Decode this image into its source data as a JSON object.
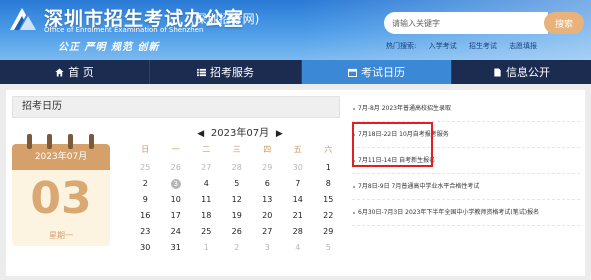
{
  "header": {
    "title": "深圳市招生考试办公室",
    "subtitle": "(深圳招考网)",
    "english": "Office of Enrolment Examination of Shenzhen",
    "slogan": "公正  严明  规范  创新",
    "search": {
      "placeholder": "请输入关键字",
      "button": "搜索"
    },
    "hot_label": "热门搜索:",
    "hot_items": [
      "入学考试",
      "招生考试",
      "志愿填报"
    ]
  },
  "nav": [
    {
      "label": "首 页",
      "icon": "home-icon",
      "active": false
    },
    {
      "label": "招考服务",
      "icon": "list-icon",
      "active": false
    },
    {
      "label": "考试日历",
      "icon": "calendar-icon",
      "active": true
    },
    {
      "label": "信息公开",
      "icon": "document-icon",
      "active": false
    }
  ],
  "section_title": "招考日历",
  "date_card": {
    "month": "2023年07月",
    "day": "03",
    "weekday": "星期一"
  },
  "calendar": {
    "title": "2023年07月",
    "prev": "◀",
    "next": "▶",
    "weekdays": [
      "日",
      "一",
      "二",
      "三",
      "四",
      "五",
      "六"
    ],
    "rows": [
      [
        {
          "d": "25",
          "m": true
        },
        {
          "d": "26",
          "m": true
        },
        {
          "d": "27",
          "m": true
        },
        {
          "d": "28",
          "m": true
        },
        {
          "d": "29",
          "m": true
        },
        {
          "d": "30",
          "m": true
        },
        {
          "d": "1",
          "m": false
        }
      ],
      [
        {
          "d": "2",
          "m": false
        },
        {
          "d": "3",
          "m": false,
          "today": true
        },
        {
          "d": "4",
          "m": false
        },
        {
          "d": "5",
          "m": false
        },
        {
          "d": "6",
          "m": false
        },
        {
          "d": "7",
          "m": false
        },
        {
          "d": "8",
          "m": false
        }
      ],
      [
        {
          "d": "9",
          "m": false
        },
        {
          "d": "10",
          "m": false
        },
        {
          "d": "11",
          "m": false
        },
        {
          "d": "12",
          "m": false
        },
        {
          "d": "13",
          "m": false
        },
        {
          "d": "14",
          "m": false
        },
        {
          "d": "15",
          "m": false
        }
      ],
      [
        {
          "d": "16",
          "m": false
        },
        {
          "d": "17",
          "m": false
        },
        {
          "d": "18",
          "m": false
        },
        {
          "d": "19",
          "m": false
        },
        {
          "d": "20",
          "m": false
        },
        {
          "d": "21",
          "m": false
        },
        {
          "d": "22",
          "m": false
        }
      ],
      [
        {
          "d": "23",
          "m": false
        },
        {
          "d": "24",
          "m": false
        },
        {
          "d": "25",
          "m": false
        },
        {
          "d": "26",
          "m": false
        },
        {
          "d": "27",
          "m": false
        },
        {
          "d": "28",
          "m": false
        },
        {
          "d": "29",
          "m": false
        }
      ],
      [
        {
          "d": "30",
          "m": false
        },
        {
          "d": "31",
          "m": false
        },
        {
          "d": "1",
          "m": true
        },
        {
          "d": "2",
          "m": true
        },
        {
          "d": "3",
          "m": true
        },
        {
          "d": "4",
          "m": true
        },
        {
          "d": "5",
          "m": true
        }
      ]
    ]
  },
  "events": [
    "7月-8月 2023年普通高校招生录取",
    "7月18日-22日 10月自考报考服务",
    "7月11日-14日 自考新生报名",
    "7月8日-9日 7月普通高中学业水平合格性考试",
    "6月30日-7月3日 2023年下半年全国中小学教师资格考试(笔试)报名"
  ],
  "colors": {
    "header_blue": "#2a7ad6",
    "nav_bg": "#1c2c50",
    "nav_active": "#3a88d6",
    "card_gold": "#d5a06a",
    "highlight_red": "#e02020"
  }
}
